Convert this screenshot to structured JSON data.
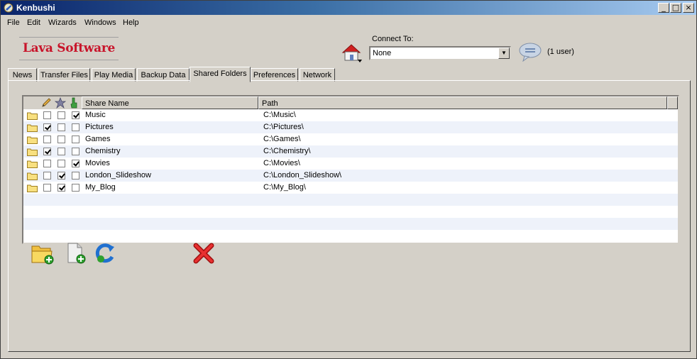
{
  "window": {
    "title": "Kenbushi",
    "minimize": "_",
    "maximize": "□",
    "close": "×"
  },
  "menu": [
    "File",
    "Edit",
    "Wizards",
    "Windows",
    "Help"
  ],
  "logo": "Lava Software",
  "connect": {
    "label": "Connect To:",
    "value": "None",
    "users": "(1 user)"
  },
  "tabs": [
    "News",
    "Transfer Files",
    "Play Media",
    "Backup Data",
    "Shared Folders",
    "Preferences",
    "Network"
  ],
  "active_tab": "Shared Folders",
  "columns": {
    "name": "Share Name",
    "path": "Path"
  },
  "header_icons": [
    "pencil-icon",
    "star-icon",
    "hand-icon"
  ],
  "shares": [
    {
      "name": "Music",
      "path": "C:\\Music\\",
      "c1": false,
      "c2": false,
      "c3": true
    },
    {
      "name": "Pictures",
      "path": "C:\\Pictures\\",
      "c1": true,
      "c2": false,
      "c3": false
    },
    {
      "name": "Games",
      "path": "C:\\Games\\",
      "c1": false,
      "c2": false,
      "c3": false
    },
    {
      "name": "Chemistry",
      "path": "C:\\Chemistry\\",
      "c1": true,
      "c2": false,
      "c3": false
    },
    {
      "name": "Movies",
      "path": "C:\\Movies\\",
      "c1": false,
      "c2": false,
      "c3": true
    },
    {
      "name": "London_Slideshow",
      "path": "C:\\London_Slideshow\\",
      "c1": false,
      "c2": true,
      "c3": false
    },
    {
      "name": "My_Blog",
      "path": "C:\\My_Blog\\",
      "c1": false,
      "c2": true,
      "c3": false
    }
  ],
  "toolbar_icons": [
    "add-folder-icon",
    "add-file-icon",
    "refresh-icon",
    "delete-icon"
  ],
  "colors": {
    "logo": "#c8142a",
    "titlebar": "#0a246a",
    "row_alt": "#eef2fa",
    "delete": "#e02020"
  }
}
